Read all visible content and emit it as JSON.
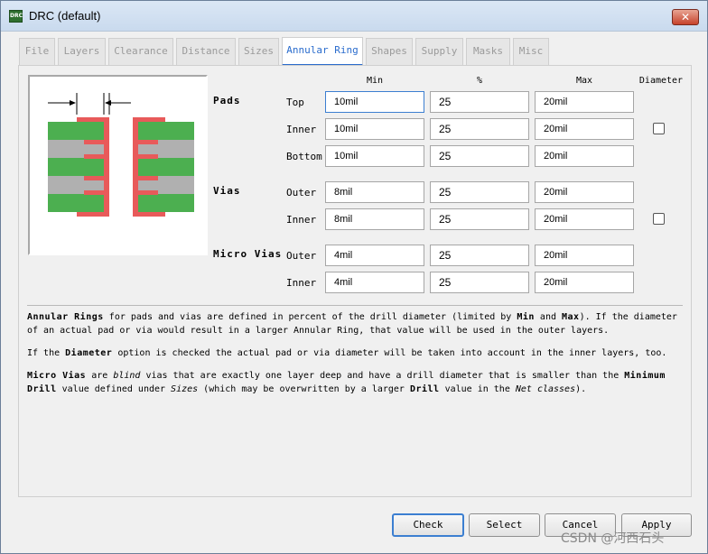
{
  "window": {
    "title": "DRC (default)",
    "icon_text": "DRC"
  },
  "tabs": [
    {
      "label": "File"
    },
    {
      "label": "Layers"
    },
    {
      "label": "Clearance"
    },
    {
      "label": "Distance"
    },
    {
      "label": "Sizes"
    },
    {
      "label": "Annular Ring",
      "active": true
    },
    {
      "label": "Shapes"
    },
    {
      "label": "Supply"
    },
    {
      "label": "Masks"
    },
    {
      "label": "Misc"
    }
  ],
  "columns": {
    "min": "Min",
    "percent": "%",
    "max": "Max",
    "diameter": "Diameter"
  },
  "groups": {
    "pads": {
      "label": "Pads",
      "rows": [
        {
          "label": "Top",
          "min": "10mil",
          "percent": "25",
          "max": "20mil"
        },
        {
          "label": "Inner",
          "min": "10mil",
          "percent": "25",
          "max": "20mil"
        },
        {
          "label": "Bottom",
          "min": "10mil",
          "percent": "25",
          "max": "20mil"
        }
      ],
      "diameter_checked": false
    },
    "vias": {
      "label": "Vias",
      "rows": [
        {
          "label": "Outer",
          "min": "8mil",
          "percent": "25",
          "max": "20mil"
        },
        {
          "label": "Inner",
          "min": "8mil",
          "percent": "25",
          "max": "20mil"
        }
      ],
      "diameter_checked": false
    },
    "micro_vias": {
      "label": "Micro Vias",
      "rows": [
        {
          "label": "Outer",
          "min": "4mil",
          "percent": "25",
          "max": "20mil"
        },
        {
          "label": "Inner",
          "min": "4mil",
          "percent": "25",
          "max": "20mil"
        }
      ]
    }
  },
  "description": {
    "p1_t1": "Annular Rings",
    "p1_t2": " for pads and vias are defined in percent of the drill diameter (limited by ",
    "p1_t3": "Min",
    "p1_t4": " and ",
    "p1_t5": "Max",
    "p1_t6": "). If the diameter of an actual pad or via would result in a larger Annular Ring, that value will be used in the outer layers.",
    "p2_t1": "If the ",
    "p2_t2": "Diameter",
    "p2_t3": " option is checked the actual pad or via diameter will be taken into account in the inner layers, too.",
    "p3_t1": "Micro Vias",
    "p3_t2": " are ",
    "p3_t3": "blind",
    "p3_t4": " vias that are exactly one layer deep and have a drill diameter that is smaller than the ",
    "p3_t5": "Minimum Drill",
    "p3_t6": " value defined under ",
    "p3_t7": "Sizes",
    "p3_t8": " (which may be overwritten by a larger ",
    "p3_t9": "Drill",
    "p3_t10": " value in the ",
    "p3_t11": "Net classes",
    "p3_t12": ")."
  },
  "buttons": {
    "check": "Check",
    "select": "Select",
    "cancel": "Cancel",
    "apply": "Apply"
  },
  "watermark": "CSDN @河西石头",
  "colors": {
    "copper": "#4caf50",
    "annular_ring": "#e85a5a",
    "dielectric": "#b0b0b0",
    "accent": "#2a6ccd"
  }
}
